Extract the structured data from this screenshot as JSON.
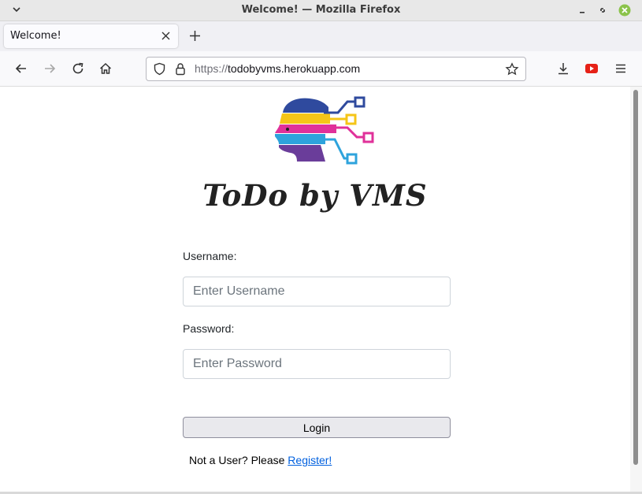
{
  "window": {
    "title": "Welcome! — Mozilla Firefox"
  },
  "tab": {
    "label": "Welcome!"
  },
  "navbar": {
    "url_scheme": "https://",
    "url_host": "todobyvms.herokuapp.com"
  },
  "page": {
    "brand": "ToDo by VMS",
    "username_label": "Username:",
    "username_placeholder": "Enter Username",
    "username_value": "",
    "password_label": "Password:",
    "password_placeholder": "Enter Password",
    "password_value": "",
    "login_label": "Login",
    "register_prompt": "Not a User? Please ",
    "register_link": "Register!"
  },
  "colors": {
    "logo_blue": "#2f4a9e",
    "logo_yellow": "#f5c518",
    "logo_magenta": "#e0319a",
    "logo_cyan": "#2ea3dc",
    "logo_purple": "#6a3d9a",
    "link": "#0060df"
  },
  "icons": {
    "window_menu": "chevron-down-icon",
    "minimize": "minimize-icon",
    "maximize": "maximize-icon",
    "close": "close-icon",
    "tab_close": "close-icon",
    "new_tab": "plus-icon",
    "back": "arrow-left-icon",
    "forward": "arrow-right-icon",
    "reload": "reload-icon",
    "home": "home-icon",
    "tracking": "shield-icon",
    "lock": "lock-icon",
    "bookmark": "star-icon",
    "downloads": "download-icon",
    "extension": "youtube-icon",
    "menu": "hamburger-menu-icon"
  }
}
